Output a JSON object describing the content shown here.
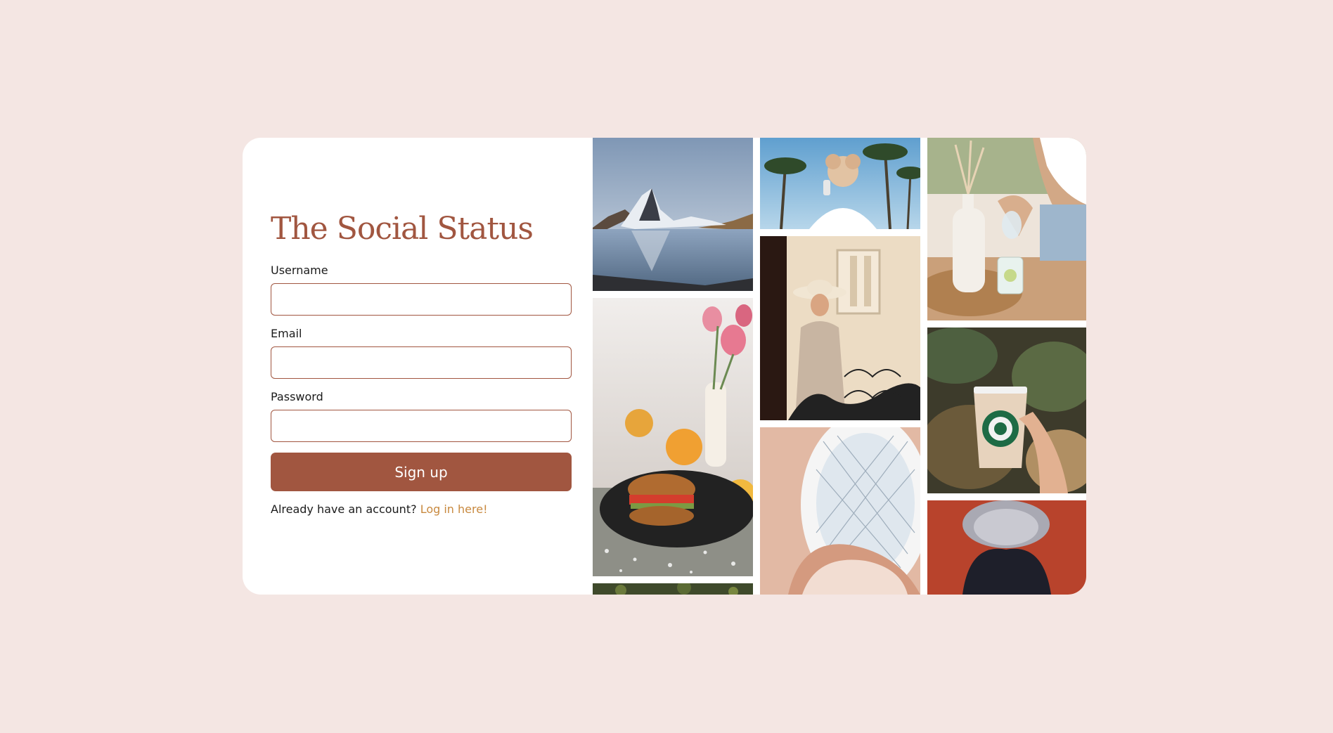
{
  "app": {
    "title": "The Social Status"
  },
  "form": {
    "username_label": "Username",
    "username_value": "",
    "email_label": "Email",
    "email_value": "",
    "password_label": "Password",
    "password_value": "",
    "signup_label": "Sign up",
    "login_prompt": "Already have an account?",
    "login_link": "Log in here!"
  },
  "gallery": {
    "photos": [
      "mountain-lake-photo",
      "burger-table-photo",
      "plant-photo",
      "palm-photo",
      "woman-hat-balcony-photo",
      "atrium-photo",
      "pouring-water-photo",
      "starbucks-drink-photo",
      "grey-hair-photo"
    ]
  },
  "colors": {
    "background": "#f4e6e3",
    "accent": "#a15640",
    "link": "#c8893f",
    "card": "#ffffff"
  }
}
